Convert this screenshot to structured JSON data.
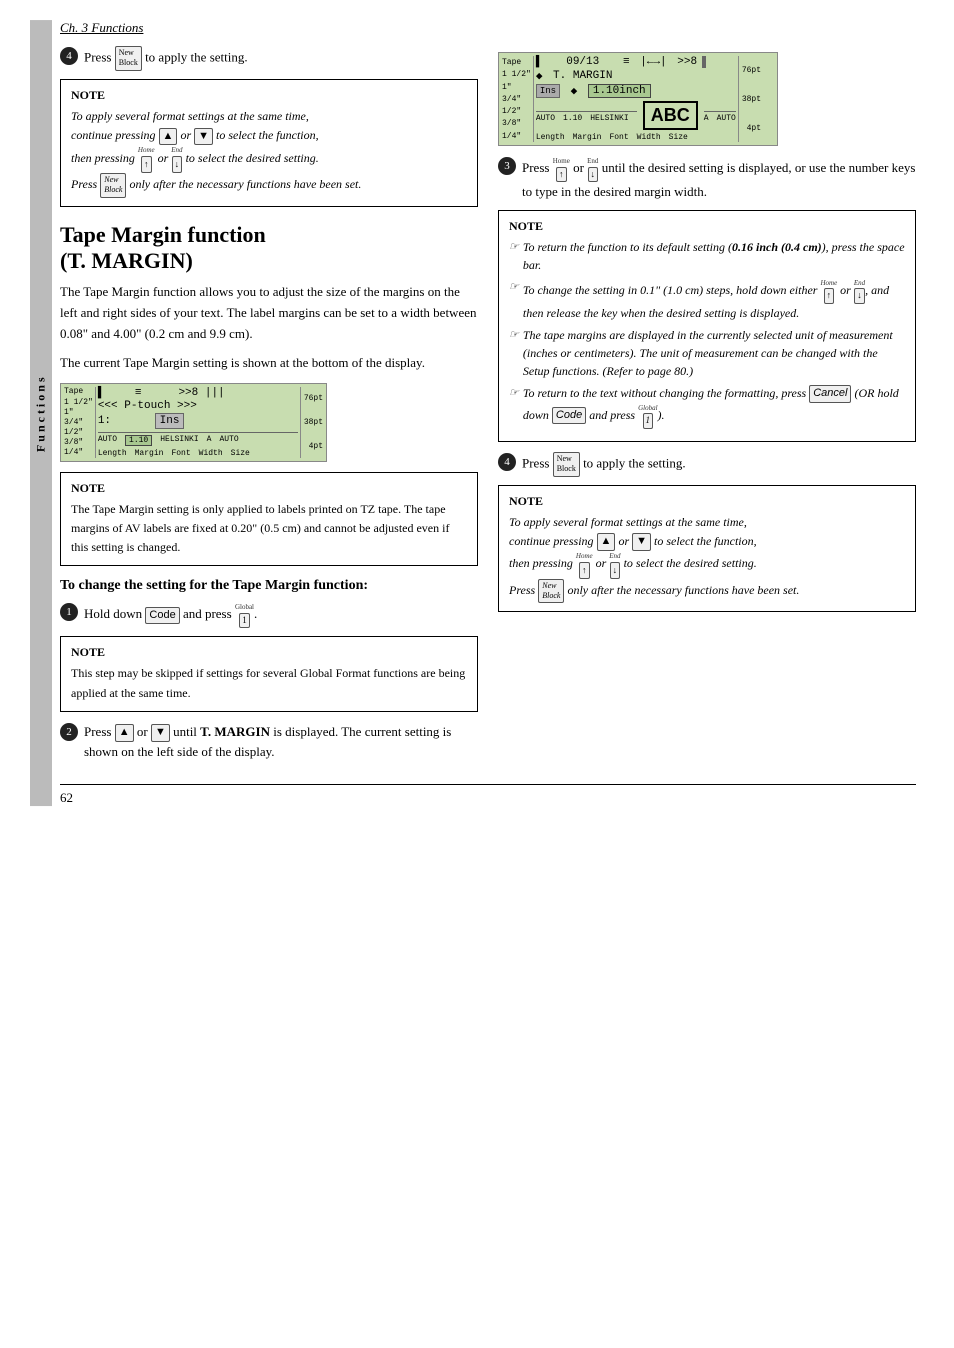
{
  "page": {
    "chapter_heading": "Ch. 3 Functions",
    "page_number": "62",
    "sidebar_label": "Functions"
  },
  "top_section": {
    "step4_label": "4",
    "step4_text": "Press",
    "step4_suffix": "to apply the setting.",
    "note_label": "NOTE",
    "note_lines": [
      "To apply several format settings at the same time,",
      "continue pressing ▲ or ▼ to select the function,",
      "then pressing Home or End to select the desired setting.",
      "Press New Block only after the necessary functions have been set."
    ]
  },
  "tape_margin_section": {
    "title": "Tape Margin function",
    "title2": "(T. MARGIN)",
    "para1": "The Tape Margin function allows you to adjust the size of the margins on the left and right sides of your text. The label margins can be set to a width between 0.08\" and 4.00\" (0.2 cm and 9.9 cm).",
    "para2": "The current Tape Margin setting is shown at the bottom of the display.",
    "lcd1": {
      "tape_sizes": [
        "1 1/2\"",
        "1\"",
        "3/4\"",
        "1/2\"",
        "3/8\"",
        "1/4\""
      ],
      "line1": "<<< P-touch >>>",
      "line2": "1:",
      "margin_val": "1.10",
      "bottom": [
        "AUTO",
        "1.10",
        "HELSINKI",
        "A",
        "AUTO"
      ],
      "labels": [
        "Length",
        "Margin",
        "Font",
        "Width",
        "Size"
      ],
      "sizes": [
        "76pt",
        "38pt",
        "4pt"
      ]
    },
    "note2_label": "NOTE",
    "note2_text": "The Tape Margin setting is only applied to labels printed on TZ tape. The tape margins of AV labels are fixed at 0.20\" (0.5 cm) and cannot be adjusted even if this setting is changed.",
    "change_title": "To change the setting for the Tape Margin function:",
    "step1_label": "1",
    "step1_text": "Hold down",
    "step1_code": "Code",
    "step1_and": "and press",
    "step1_global": "Global",
    "step1_key": "1",
    "note3_label": "NOTE",
    "note3_text": "This step may be skipped if settings for several Global Format functions are being applied at the same time.",
    "step2_label": "2",
    "step2_text": "Press",
    "step2_or": "or",
    "step2_suffix": "until T. MARGIN is displayed. The current setting is shown on the left side of the display.",
    "step2_tmargin_bold": "T. MARGIN"
  },
  "right_col": {
    "lcd2": {
      "tape_sizes": [
        "1 1/2\"",
        "1\"",
        "3/4\"",
        "1/2\"",
        "3/8\"",
        "1/4\""
      ],
      "date_line": "09/13",
      "margin_label": "T. MARGIN",
      "margin_val": "1.10inch",
      "bottom": [
        "AUTO",
        "1.10",
        "HELSINKI",
        "A",
        "AUTO"
      ],
      "labels": [
        "Length",
        "Margin",
        "Font",
        "Width",
        "Size"
      ],
      "sizes": [
        "76pt",
        "38pt",
        "4pt"
      ],
      "abc": "ABC"
    },
    "step3_label": "3",
    "step3_text": "Press",
    "step3_home": "Home",
    "step3_or": "or",
    "step3_end": "End",
    "step3_suffix": "until the desired setting is displayed, or use the number keys to type in the desired margin width.",
    "note4_label": "NOTE",
    "note4_items": [
      {
        "icon": "☞",
        "text": "To return the function to its default setting (0.16 inch (0.4 cm)), press the space bar."
      },
      {
        "icon": "☞",
        "text": "To change the setting in 0.1\" (1.0 cm) steps, hold down either Home or End, and then release the key when the desired setting is displayed."
      },
      {
        "icon": "☞",
        "text": "The tape margins are displayed in the currently selected unit of measurement (inches or centimeters). The unit of measurement can be changed with the Setup functions. (Refer to page 80.)"
      },
      {
        "icon": "☞",
        "text": "To return to the text without changing the formatting, press Cancel (OR hold down Code and press 1)."
      }
    ],
    "step4_label": "4",
    "step4_text": "Press",
    "step4_suffix": "to apply the setting.",
    "note5_label": "NOTE",
    "note5_lines": [
      "To apply several format settings at the same time,",
      "continue pressing ▲ or ▼ to select the function,",
      "then pressing Home or End to select the desired setting.",
      "Press New Block only after the necessary functions have been set."
    ]
  }
}
